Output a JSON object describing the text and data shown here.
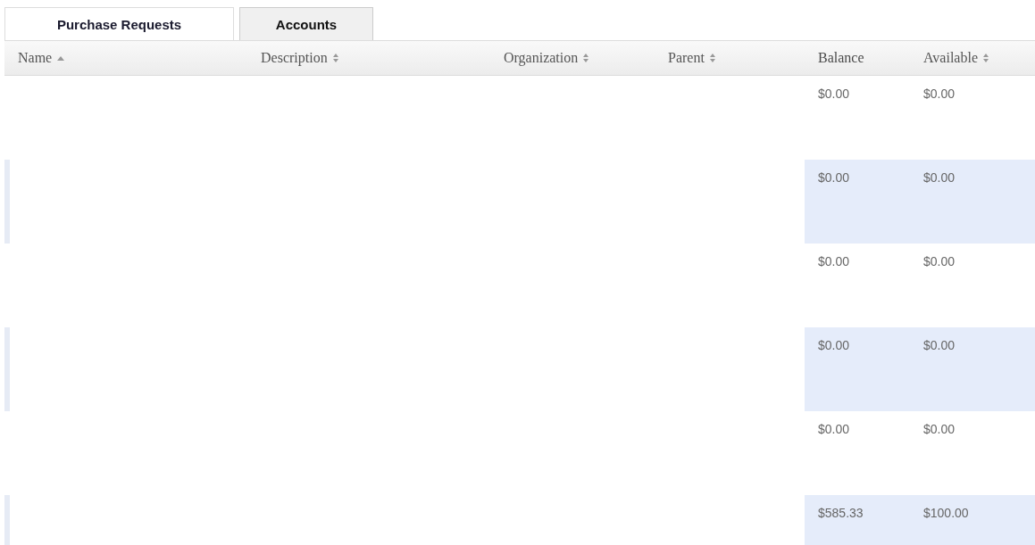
{
  "tabs": [
    {
      "label": "Purchase Requests",
      "selected": false
    },
    {
      "label": "Accounts",
      "selected": true
    }
  ],
  "table": {
    "columns": [
      {
        "label": "Name",
        "sorted_ascending": true,
        "sortable": true
      },
      {
        "label": "Description",
        "sorted_ascending": false,
        "sortable": true
      },
      {
        "label": "Organization",
        "sorted_ascending": false,
        "sortable": true
      },
      {
        "label": "Parent",
        "sorted_ascending": false,
        "sortable": true
      },
      {
        "label": "Balance",
        "sorted_ascending": false,
        "sortable": false
      },
      {
        "label": "Available",
        "sorted_ascending": false,
        "sortable": true
      }
    ],
    "rows": [
      {
        "balance": "$0.00",
        "available": "$0.00",
        "striped": false
      },
      {
        "balance": "$0.00",
        "available": "$0.00",
        "striped": true
      },
      {
        "balance": "$0.00",
        "available": "$0.00",
        "striped": false
      },
      {
        "balance": "$0.00",
        "available": "$0.00",
        "striped": true
      },
      {
        "balance": "$0.00",
        "available": "$0.00",
        "striped": false
      },
      {
        "balance": "$585.33",
        "available": "$100.00",
        "striped": true
      }
    ]
  }
}
